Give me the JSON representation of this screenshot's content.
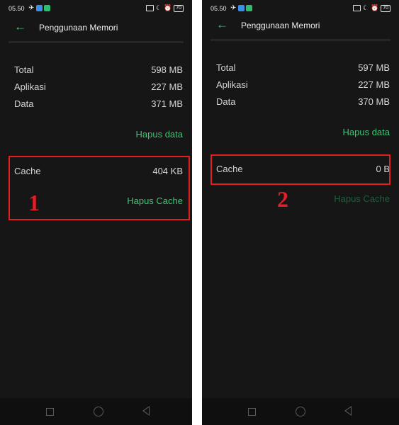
{
  "screens": [
    {
      "status_time": "05.50",
      "battery": "70",
      "title": "Penggunaan Memori",
      "total_label": "Total",
      "total_value": "598 MB",
      "apps_label": "Aplikasi",
      "apps_value": "227 MB",
      "data_label": "Data",
      "data_value": "371 MB",
      "clear_data": "Hapus data",
      "cache_label": "Cache",
      "cache_value": "404 KB",
      "clear_cache": "Hapus Cache",
      "marker": "1"
    },
    {
      "status_time": "05.50",
      "battery": "70",
      "title": "Penggunaan Memori",
      "total_label": "Total",
      "total_value": "597 MB",
      "apps_label": "Aplikasi",
      "apps_value": "227 MB",
      "data_label": "Data",
      "data_value": "370 MB",
      "clear_data": "Hapus data",
      "cache_label": "Cache",
      "cache_value": "0 B",
      "clear_cache": "Hapus Cache",
      "marker": "2"
    }
  ],
  "colors": {
    "accent": "#3ec477",
    "accent_disabled": "#1f5d3c",
    "highlight": "#e02020",
    "background": "#161616"
  },
  "icons": [
    "back-arrow-icon",
    "airplane-icon",
    "cast-icon",
    "moon-icon",
    "alarm-icon",
    "battery-icon",
    "nav-square-icon",
    "nav-home-icon",
    "nav-back-icon"
  ]
}
